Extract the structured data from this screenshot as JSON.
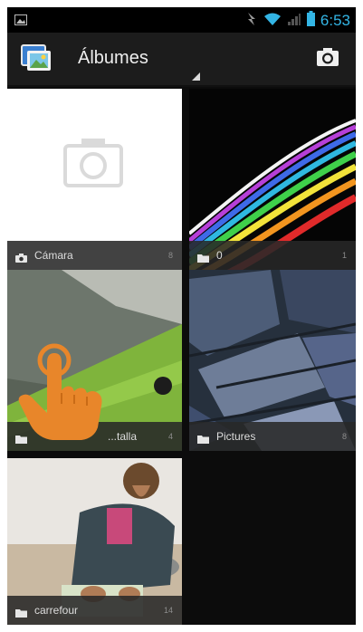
{
  "status_bar": {
    "time": "6:53",
    "icons": [
      "image-notification-icon",
      "signal-boost-icon",
      "wifi-icon",
      "cell-signal-icon",
      "battery-icon"
    ],
    "accent_color": "#33b5e5"
  },
  "action_bar": {
    "title": "Álbumes",
    "app_icon": "gallery-app-icon",
    "camera_icon": "camera-icon"
  },
  "albums": [
    {
      "name": "Cámara",
      "count": "8",
      "icon": "camera-icon"
    },
    {
      "name": "0",
      "count": "1",
      "icon": "folder-icon"
    },
    {
      "name": "Captura de pantalla",
      "visible_name": "...talla",
      "count": "4",
      "icon": "folder-icon"
    },
    {
      "name": "Pictures",
      "count": "8",
      "icon": "folder-icon"
    },
    {
      "name": "carrefour",
      "count": "14",
      "icon": "folder-icon"
    }
  ],
  "overlay": {
    "icon": "tap-hand-icon"
  }
}
